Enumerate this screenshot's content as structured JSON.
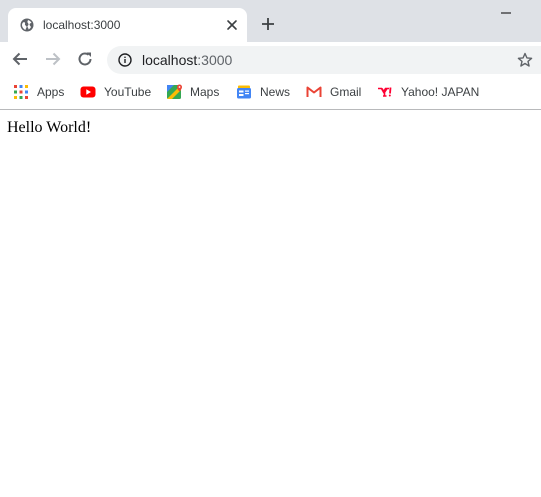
{
  "tab": {
    "title": "localhost:3000"
  },
  "address": {
    "host": "localhost",
    "port_suffix": ":3000"
  },
  "bookmarks": [
    {
      "label": "Apps",
      "icon": "apps-grid-icon"
    },
    {
      "label": "YouTube",
      "icon": "youtube-icon"
    },
    {
      "label": "Maps",
      "icon": "maps-icon"
    },
    {
      "label": "News",
      "icon": "news-icon"
    },
    {
      "label": "Gmail",
      "icon": "gmail-icon"
    },
    {
      "label": "Yahoo! JAPAN",
      "icon": "yahoo-japan-icon"
    }
  ],
  "page": {
    "text": "Hello World!"
  },
  "colors": {
    "tabstrip": "#dee1e6",
    "omnibox": "#f1f3f4",
    "icon": "#5f6368",
    "youtube": "#ff0000",
    "yahoo": "#ff0033"
  }
}
